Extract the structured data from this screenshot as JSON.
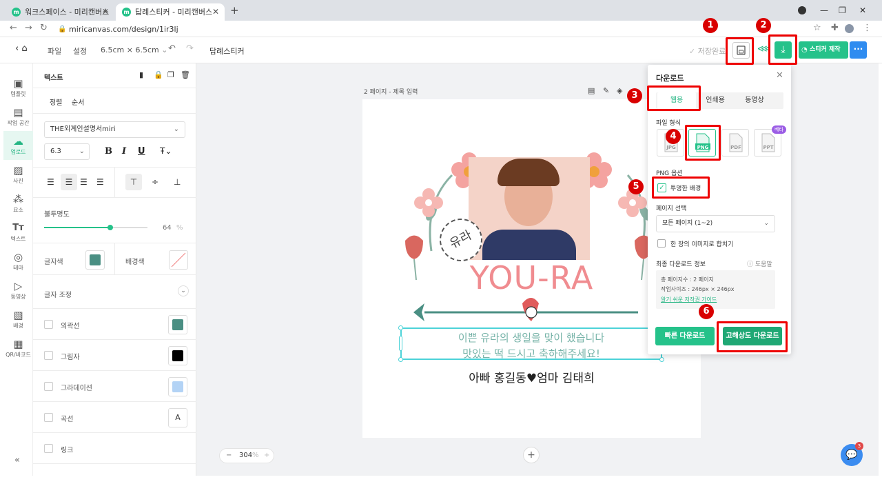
{
  "browser": {
    "tabs": [
      {
        "title": "워크스페이스 - 미리캔버스"
      },
      {
        "title": "답례스티커 - 미리캔버스"
      }
    ],
    "new_tab": "+",
    "url": "miricanvas.com/design/1ir3lj"
  },
  "header": {
    "menu_file": "파일",
    "menu_settings": "설정",
    "size": "6.5cm × 6.5cm",
    "doc_title": "답례스티커",
    "save_status": "저장완료",
    "sticker_button": "스티커 제작",
    "more": "···"
  },
  "rail": {
    "items": [
      {
        "label": "템플릿",
        "icon": "template-icon"
      },
      {
        "label": "작업 공간",
        "icon": "workspace-icon"
      },
      {
        "label": "업로드",
        "icon": "upload-icon"
      },
      {
        "label": "사진",
        "icon": "photo-icon"
      },
      {
        "label": "요소",
        "icon": "element-icon"
      },
      {
        "label": "텍스트",
        "icon": "text-icon"
      },
      {
        "label": "테마",
        "icon": "theme-icon"
      },
      {
        "label": "동영상",
        "icon": "video-icon"
      },
      {
        "label": "배경",
        "icon": "background-icon"
      },
      {
        "label": "QR/바코드",
        "icon": "qr-icon"
      }
    ],
    "collapse": "«"
  },
  "props": {
    "title": "텍스트",
    "tab_align": "정렬",
    "tab_order": "순서",
    "font": "THE외계인설명서miri",
    "font_size": "6.3",
    "opacity_label": "불투명도",
    "opacity_value": "64",
    "opacity_unit": "%",
    "opacity_level": 0.64,
    "text_color_label": "글자색",
    "bg_color_label": "배경색",
    "text_color": "#4a8f83",
    "adjust_label": "글자 조정",
    "effects": [
      {
        "label": "외곽선",
        "color": "#4a8f83"
      },
      {
        "label": "그림자",
        "color": "#000000"
      },
      {
        "label": "그라데이션",
        "color": "#b3d3f5"
      },
      {
        "label": "곡선",
        "color": ""
      },
      {
        "label": "링크",
        "color": ""
      }
    ]
  },
  "canvas": {
    "page_label": "2 페이지 - 제목 입력",
    "zoom": "304",
    "zoom_unit": "%",
    "sticker_name": "YOU-RA",
    "stamp_text": "유라",
    "message_line1": "이쁜 유라의 생일을 맞이 했습니다",
    "message_line2": "맛있는 떡 드시고 축하해주세요!",
    "signature": "아빠 홍길동♥엄마 김태희"
  },
  "download": {
    "title": "다운로드",
    "tabs": [
      "웹용",
      "인쇄용",
      "동영상"
    ],
    "file_format_label": "파일 형식",
    "formats": [
      "JPG",
      "PNG",
      "PDF",
      "PPT"
    ],
    "beta": "베타",
    "png_options_label": "PNG 옵션",
    "transparent_bg": "투명한 배경",
    "page_select_label": "페이지 선택",
    "page_select_value": "모든 페이지 (1~2)",
    "merge_label": "한 장의 이미지로 합치기",
    "final_info_label": "최종 다운로드 정보",
    "help": "도움말",
    "info_pages": "총 페이지수 : 2 페이지",
    "info_size": "작업사이즈 : 246px × 246px",
    "copyright_link": "알기 쉬운 저작권 가이드",
    "fast_download": "빠른 다운로드",
    "hq_download": "고해상도 다운로드"
  },
  "annotations": [
    "1",
    "2",
    "3",
    "4",
    "5",
    "6"
  ],
  "colors": {
    "accent": "#25c28a",
    "highlight": "#e00000",
    "blue": "#2f8cf0"
  },
  "chat_badge": "3"
}
